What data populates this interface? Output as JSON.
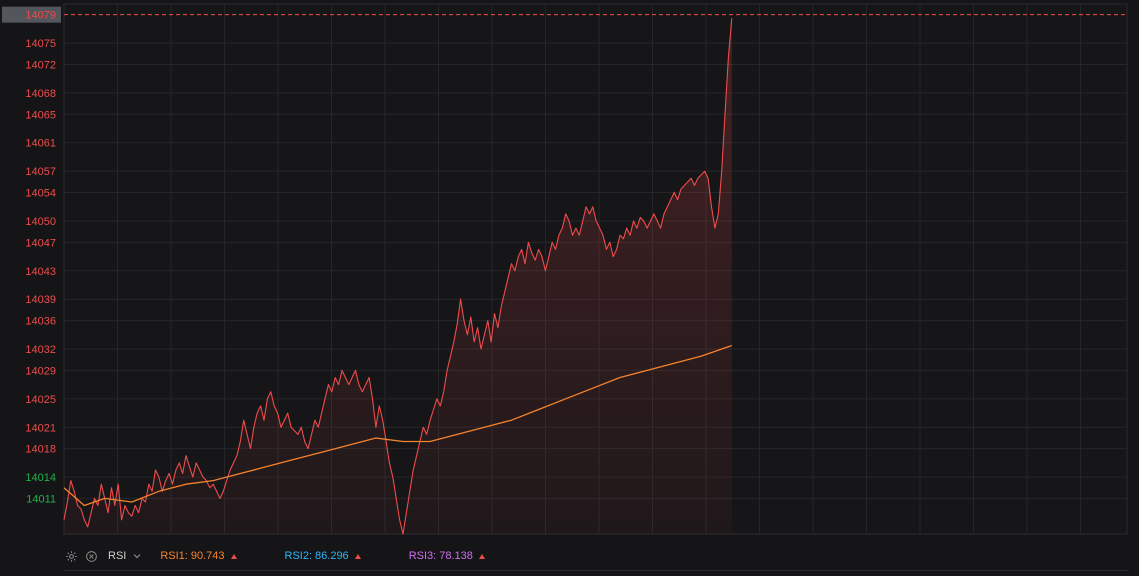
{
  "chart_data": {
    "type": "line",
    "y_axis": {
      "ticks": [
        {
          "label": "14079",
          "value": 14079,
          "color": "#ef4b4b"
        },
        {
          "label": "14075",
          "value": 14075,
          "color": "#ef4b4b"
        },
        {
          "label": "14072",
          "value": 14072,
          "color": "#ef4b4b"
        },
        {
          "label": "14068",
          "value": 14068,
          "color": "#ef4b4b"
        },
        {
          "label": "14065",
          "value": 14065,
          "color": "#ef4b4b"
        },
        {
          "label": "14061",
          "value": 14061,
          "color": "#ef4b4b"
        },
        {
          "label": "14057",
          "value": 14057,
          "color": "#ef4b4b"
        },
        {
          "label": "14054",
          "value": 14054,
          "color": "#ef4b4b"
        },
        {
          "label": "14050",
          "value": 14050,
          "color": "#ef4b4b"
        },
        {
          "label": "14047",
          "value": 14047,
          "color": "#ef4b4b"
        },
        {
          "label": "14043",
          "value": 14043,
          "color": "#ef4b4b"
        },
        {
          "label": "14039",
          "value": 14039,
          "color": "#ef4b4b"
        },
        {
          "label": "14036",
          "value": 14036,
          "color": "#ef4b4b"
        },
        {
          "label": "14032",
          "value": 14032,
          "color": "#ef4b4b"
        },
        {
          "label": "14029",
          "value": 14029,
          "color": "#ef4b4b"
        },
        {
          "label": "14025",
          "value": 14025,
          "color": "#ef4b4b"
        },
        {
          "label": "14021",
          "value": 14021,
          "color": "#ef4b4b"
        },
        {
          "label": "14018",
          "value": 14018,
          "color": "#ef4b4b"
        },
        {
          "label": "14014",
          "value": 14014,
          "color": "#22b14c"
        },
        {
          "label": "14011",
          "value": 14011,
          "color": "#22b14c"
        }
      ],
      "range": [
        14006,
        14080.5
      ],
      "last_price": 14079
    },
    "x_range": [
      0,
      100
    ],
    "grid": true,
    "series": [
      {
        "color": "#ef4b4b",
        "points": [
          [
            0,
            14008
          ],
          [
            0.5,
            14010.5
          ],
          [
            1,
            14013.5
          ],
          [
            1.5,
            14012
          ],
          [
            2,
            14010
          ],
          [
            2.5,
            14009.5
          ],
          [
            3,
            14008
          ],
          [
            3.5,
            14007
          ],
          [
            4,
            14009
          ],
          [
            4.5,
            14011
          ],
          [
            5,
            14010
          ],
          [
            5.5,
            14013
          ],
          [
            6,
            14011
          ],
          [
            6.5,
            14009
          ],
          [
            7,
            14012.5
          ],
          [
            7.5,
            14010
          ],
          [
            8,
            14013
          ],
          [
            8.5,
            14008
          ],
          [
            9,
            14010
          ],
          [
            9.5,
            14009
          ],
          [
            10,
            14008.5
          ],
          [
            10.5,
            14010
          ],
          [
            11,
            14009
          ],
          [
            11.5,
            14011
          ],
          [
            12,
            14010.5
          ],
          [
            12.5,
            14013
          ],
          [
            13,
            14012
          ],
          [
            13.5,
            14015
          ],
          [
            14,
            14014
          ],
          [
            14.5,
            14012
          ],
          [
            15,
            14013.5
          ],
          [
            15.5,
            14014.5
          ],
          [
            16,
            14013
          ],
          [
            16.5,
            14015
          ],
          [
            17,
            14016
          ],
          [
            17.5,
            14014.5
          ],
          [
            18,
            14017
          ],
          [
            18.5,
            14015.5
          ],
          [
            19,
            14014
          ],
          [
            19.5,
            14016
          ],
          [
            20,
            14015
          ],
          [
            20.5,
            14014
          ],
          [
            21,
            14013.5
          ],
          [
            21.5,
            14012.5
          ],
          [
            22,
            14013
          ],
          [
            22.5,
            14012
          ],
          [
            23,
            14011
          ],
          [
            23.5,
            14012
          ],
          [
            24,
            14013.5
          ],
          [
            24.5,
            14015
          ],
          [
            25,
            14016
          ],
          [
            25.5,
            14017
          ],
          [
            26,
            14019
          ],
          [
            26.5,
            14022
          ],
          [
            27,
            14020
          ],
          [
            27.5,
            14018
          ],
          [
            28,
            14021
          ],
          [
            28.5,
            14023
          ],
          [
            29,
            14024
          ],
          [
            29.5,
            14022
          ],
          [
            30,
            14025
          ],
          [
            30.5,
            14026
          ],
          [
            31,
            14024
          ],
          [
            31.5,
            14023
          ],
          [
            32,
            14021
          ],
          [
            32.5,
            14022
          ],
          [
            33,
            14023
          ],
          [
            33.5,
            14021
          ],
          [
            34,
            14020.5
          ],
          [
            34.5,
            14020
          ],
          [
            35,
            14021
          ],
          [
            35.5,
            14019
          ],
          [
            36,
            14018
          ],
          [
            36.5,
            14020
          ],
          [
            37,
            14022
          ],
          [
            37.5,
            14021
          ],
          [
            38,
            14023
          ],
          [
            38.5,
            14025
          ],
          [
            39,
            14027
          ],
          [
            39.5,
            14026
          ],
          [
            40,
            14028
          ],
          [
            40.5,
            14027
          ],
          [
            41,
            14029
          ],
          [
            41.5,
            14028
          ],
          [
            42,
            14027
          ],
          [
            42.5,
            14028
          ],
          [
            43,
            14029
          ],
          [
            43.5,
            14027
          ],
          [
            44,
            14026
          ],
          [
            44.5,
            14027
          ],
          [
            45,
            14028
          ],
          [
            45.5,
            14025
          ],
          [
            46,
            14021
          ],
          [
            46.5,
            14024
          ],
          [
            47,
            14022
          ],
          [
            47.5,
            14019
          ],
          [
            48,
            14016
          ],
          [
            48.5,
            14014
          ],
          [
            49,
            14011
          ],
          [
            49.5,
            14008
          ],
          [
            50,
            14006
          ],
          [
            50.5,
            14009
          ],
          [
            51,
            14012
          ],
          [
            51.5,
            14015
          ],
          [
            52,
            14017
          ],
          [
            52.5,
            14019
          ],
          [
            53,
            14021
          ],
          [
            53.5,
            14020
          ],
          [
            54,
            14022
          ],
          [
            54.5,
            14023.5
          ],
          [
            55,
            14025
          ],
          [
            55.5,
            14024
          ],
          [
            56,
            14026
          ],
          [
            56.5,
            14029
          ],
          [
            57,
            14031
          ],
          [
            57.5,
            14033
          ],
          [
            58,
            14035.5
          ],
          [
            58.5,
            14039
          ],
          [
            59,
            14036
          ],
          [
            59.5,
            14034
          ],
          [
            60,
            14036.5
          ],
          [
            60.5,
            14033
          ],
          [
            61,
            14035
          ],
          [
            61.5,
            14032
          ],
          [
            62,
            14034
          ],
          [
            62.5,
            14036
          ],
          [
            63,
            14033
          ],
          [
            63.5,
            14037
          ],
          [
            64,
            14035
          ],
          [
            64.5,
            14038
          ],
          [
            65,
            14040
          ],
          [
            65.5,
            14042
          ],
          [
            66,
            14044
          ],
          [
            66.5,
            14043
          ],
          [
            67,
            14045
          ],
          [
            67.5,
            14046
          ],
          [
            68,
            14044
          ],
          [
            68.5,
            14047
          ],
          [
            69,
            14045.5
          ],
          [
            69.5,
            14044.5
          ],
          [
            70,
            14046
          ],
          [
            70.5,
            14045
          ],
          [
            71,
            14043
          ],
          [
            71.5,
            14045
          ],
          [
            72,
            14047
          ],
          [
            72.5,
            14046
          ],
          [
            73,
            14048
          ],
          [
            73.5,
            14049
          ],
          [
            74,
            14051
          ],
          [
            74.5,
            14050
          ],
          [
            75,
            14048
          ],
          [
            75.5,
            14049
          ],
          [
            76,
            14048
          ],
          [
            76.5,
            14050
          ],
          [
            77,
            14052
          ],
          [
            77.5,
            14051
          ],
          [
            78,
            14052
          ],
          [
            78.5,
            14050
          ],
          [
            79,
            14049
          ],
          [
            79.5,
            14048
          ],
          [
            80,
            14046
          ],
          [
            80.5,
            14047
          ],
          [
            81,
            14045
          ],
          [
            81.5,
            14046
          ],
          [
            82,
            14048
          ],
          [
            82.5,
            14047.5
          ],
          [
            83,
            14049
          ],
          [
            83.5,
            14048
          ],
          [
            84,
            14050
          ],
          [
            84.5,
            14049
          ],
          [
            85,
            14050.5
          ],
          [
            85.5,
            14050
          ],
          [
            86,
            14049
          ],
          [
            86.5,
            14050
          ],
          [
            87,
            14051
          ],
          [
            87.5,
            14050
          ],
          [
            88,
            14049
          ],
          [
            88.5,
            14051
          ],
          [
            89,
            14052
          ],
          [
            89.5,
            14053
          ],
          [
            90,
            14054
          ],
          [
            90.5,
            14053
          ],
          [
            91,
            14054.5
          ],
          [
            91.5,
            14055
          ],
          [
            92,
            14055.5
          ],
          [
            92.5,
            14056
          ],
          [
            93,
            14055
          ],
          [
            93.5,
            14056
          ],
          [
            94,
            14056.5
          ],
          [
            94.5,
            14057
          ],
          [
            95,
            14056
          ],
          [
            95.5,
            14052
          ],
          [
            96,
            14049
          ],
          [
            96.5,
            14051
          ],
          [
            97,
            14057
          ],
          [
            97.5,
            14065
          ],
          [
            98,
            14073
          ],
          [
            98.5,
            14078.5
          ]
        ]
      },
      {
        "color": "#f7832d",
        "points": [
          [
            0,
            14012.5
          ],
          [
            3,
            14010
          ],
          [
            6,
            14011
          ],
          [
            10,
            14010.5
          ],
          [
            14,
            14012
          ],
          [
            18,
            14013
          ],
          [
            22,
            14013.5
          ],
          [
            26,
            14014.5
          ],
          [
            30,
            14015.5
          ],
          [
            34,
            14016.5
          ],
          [
            38,
            14017.5
          ],
          [
            42,
            14018.5
          ],
          [
            46,
            14019.5
          ],
          [
            50,
            14019
          ],
          [
            54,
            14019
          ],
          [
            58,
            14020
          ],
          [
            62,
            14021
          ],
          [
            66,
            14022
          ],
          [
            70,
            14023.5
          ],
          [
            74,
            14025
          ],
          [
            78,
            14026.5
          ],
          [
            82,
            14028
          ],
          [
            86,
            14029
          ],
          [
            90,
            14030
          ],
          [
            94,
            14031
          ],
          [
            98.5,
            14032.5
          ]
        ]
      }
    ]
  },
  "indicator": {
    "name": "RSI",
    "rsi1": {
      "label": "RSI1:",
      "value": "90.743",
      "color": "#f7832d"
    },
    "rsi2": {
      "label": "RSI2:",
      "value": "86.296",
      "color": "#29b6f6"
    },
    "rsi3": {
      "label": "RSI3:",
      "value": "78.138",
      "color": "#d26ef0"
    }
  }
}
